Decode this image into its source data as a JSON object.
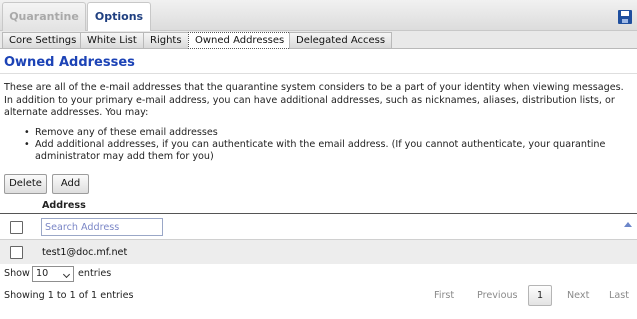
{
  "tabs": {
    "quarantine": "Quarantine",
    "options": "Options",
    "save_icon": "save-icon"
  },
  "subtabs": [
    {
      "label": "Core Settings"
    },
    {
      "label": "White List"
    },
    {
      "label": "Rights"
    },
    {
      "label": "Owned Addresses",
      "active": true
    },
    {
      "label": "Delegated Access"
    }
  ],
  "page": {
    "title": "Owned Addresses",
    "intro": "These are all of the e-mail addresses that the quarantine system considers to be a part of your identity when viewing messages. In addition to your primary e-mail address, you can have additional addresses, such as nicknames, aliases, distribution lists, or alternate addresses. You may:",
    "bullets": [
      "Remove any of these email addresses",
      "Add additional addresses, if you can authenticate with the email address. (If you cannot authenticate, your quarantine administrator may add them for you)"
    ]
  },
  "actions": {
    "delete": "Delete",
    "add": "Add"
  },
  "table": {
    "column_address": "Address",
    "search_placeholder": "Search Address",
    "rows": [
      {
        "address": "test1@doc.mf.net"
      }
    ]
  },
  "length": {
    "show": "Show",
    "value": "10",
    "entries": "entries"
  },
  "footer": {
    "info": "Showing 1 to 1 of 1 entries",
    "first": "First",
    "previous": "Previous",
    "current": "1",
    "next": "Next",
    "last": "Last"
  },
  "colors": {
    "title": "#1c43b6",
    "active_tab": "#1f3f80",
    "inactive_tab": "#a9a9a9"
  }
}
